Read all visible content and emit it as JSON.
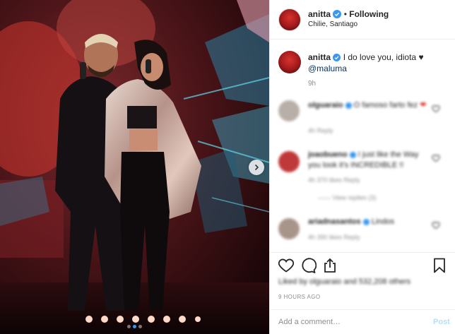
{
  "header": {
    "username": "anitta",
    "separator": "•",
    "follow_label": "Following",
    "location": "Chilie, Santiago"
  },
  "caption": {
    "username": "anitta",
    "text": "I do love you, idiota",
    "heart": "♥",
    "mention": "@maluma",
    "time": "9h"
  },
  "comments": [
    {
      "username": "olguaraio",
      "text": "O famoso farto fez",
      "heart": "❤",
      "meta": "4h   Reply",
      "avatar_color": "#b8b0a8"
    },
    {
      "username": "joaobueno",
      "text": "I just like the Way you look it's INCREDIBLE !!",
      "meta": "4h   370 likes   Reply",
      "replies": "—— View replies (3)",
      "avatar_color": "#c0393a"
    },
    {
      "username": "ariadnasantos",
      "text": "Lindos",
      "meta": "4h   390 likes   Reply",
      "avatar_color": "#a8958a"
    }
  ],
  "likes": {
    "text": "Liked by olguaraio and 532,208 others"
  },
  "timestamp": "9 HOURS AGO",
  "add_comment": {
    "placeholder": "Add a comment…",
    "post_label": "Post"
  },
  "colors": {
    "verified_blue": "#3897f0",
    "link_blue": "#003569",
    "post_disabled": "#b2dffc"
  },
  "icons": [
    "heart-icon",
    "comment-icon",
    "share-icon",
    "bookmark-icon",
    "verified-icon",
    "chevron-right-icon"
  ]
}
